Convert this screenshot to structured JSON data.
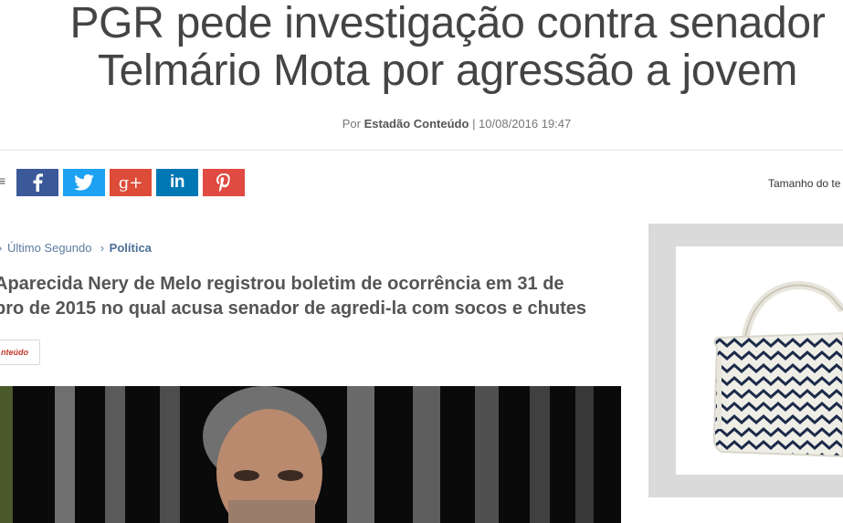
{
  "article": {
    "headline_line1": "PGR pede investigação contra senador",
    "headline_line2": "Telmário Mota por agressão a jovem",
    "byline_prefix": "Por",
    "author": "Estadão Conteúdo",
    "date": "| 10/08/2016 19:47",
    "subtitle_line1": "Aparecida Nery de Melo registrou boletim de ocorrência em 31 de",
    "subtitle_line2": "bro de 2015 no qual acusa senador de agredi-la com socos e chutes",
    "source_tag": "nteúdo"
  },
  "share": {
    "edge_glyph": "≡",
    "buttons": [
      {
        "network": "facebook",
        "icon": "facebook-icon",
        "color": "#3b5998"
      },
      {
        "network": "twitter",
        "icon": "twitter-icon",
        "color": "#1da1f2"
      },
      {
        "network": "google-plus",
        "icon": "google-plus-icon",
        "color": "#dd4b39"
      },
      {
        "network": "linkedin",
        "icon": "linkedin-icon",
        "color": "#0077b5"
      },
      {
        "network": "pinterest",
        "icon": "pinterest-icon",
        "color": "#e04a42"
      }
    ],
    "gplus_label": "g+",
    "linkedin_label": "in"
  },
  "toolbar": {
    "text_size_label": "Tamanho do te"
  },
  "breadcrumb": {
    "sep": "›",
    "item1": "Último Segundo",
    "item2": "Política"
  },
  "colors": {
    "link": "#5b7ba0",
    "source_tag": "#c0392b"
  }
}
